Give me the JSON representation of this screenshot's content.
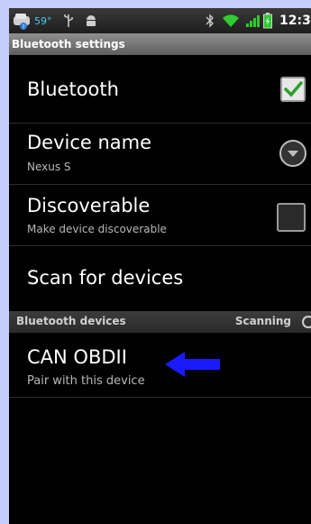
{
  "statusbar": {
    "temperature": "59°",
    "time": "12:3",
    "icons": [
      "weather-icon",
      "usb-icon",
      "android-debug-icon",
      "bluetooth-icon",
      "wifi-icon",
      "signal-icon",
      "battery-icon"
    ]
  },
  "title": "Bluetooth settings",
  "settings": {
    "bluetooth": {
      "label": "Bluetooth",
      "checked": true
    },
    "device_name": {
      "label": "Device name",
      "value": "Nexus S"
    },
    "discoverable": {
      "label": "Discoverable",
      "summary": "Make device discoverable",
      "checked": false
    },
    "scan": {
      "label": "Scan for devices"
    }
  },
  "devices_section": {
    "header": "Bluetooth devices",
    "status": "Scanning"
  },
  "devices": [
    {
      "name": "CAN OBDII",
      "action": "Pair with this device"
    }
  ],
  "colors": {
    "accent_check": "#2e9e2e",
    "status_icons": "#4fc3f7",
    "annotation_arrow": "#1a1aff",
    "page_background": "#c4cdfb"
  }
}
